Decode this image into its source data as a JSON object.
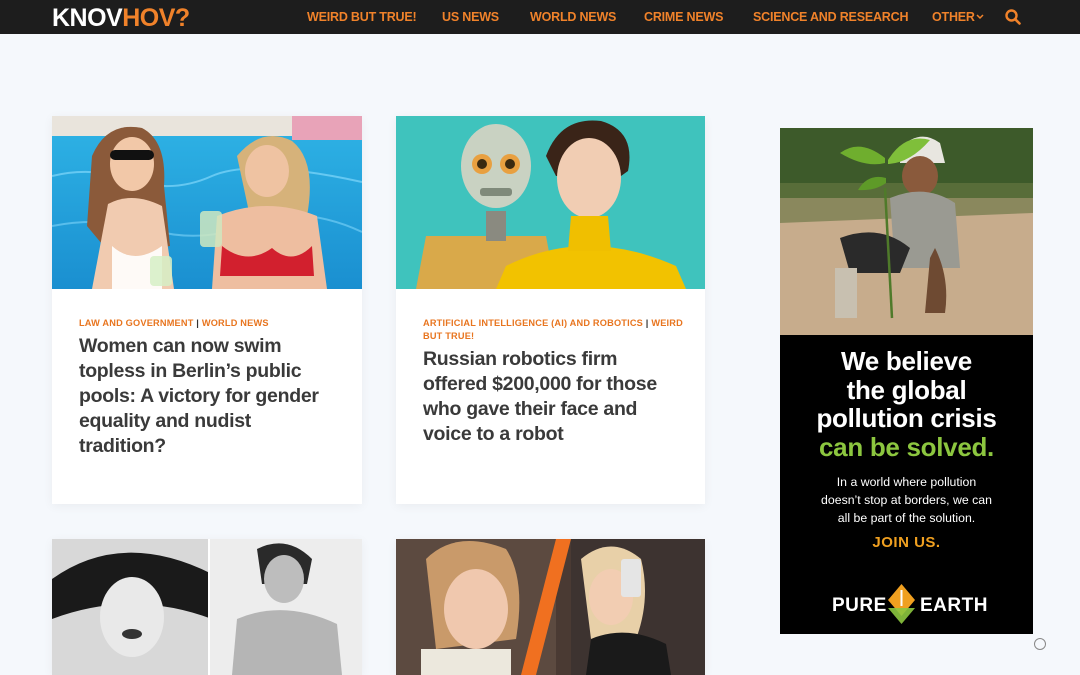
{
  "header": {
    "logo_part1": "KNOV",
    "logo_part2": "HOV?",
    "nav": [
      "WEIRD BUT TRUE!",
      "US NEWS",
      "WORLD NEWS",
      "CRIME NEWS",
      "SCIENCE AND RESEARCH",
      "OTHER"
    ],
    "search_icon": "search-icon",
    "dropdown_icon": "chevron-down-icon"
  },
  "articles": [
    {
      "cat1": "LAW AND GOVERNMENT",
      "sep": "|",
      "cat2": "WORLD NEWS",
      "title": "Women can now swim topless in Berlin’s public pools: A victory for gender equality and nudist tradition?"
    },
    {
      "cat1": "ARTIFICIAL INTELLIGENCE (AI) AND ROBOTICS",
      "sep": "|",
      "cat2": "WEIRD BUT TRUE!",
      "title": "Russian robotics firm offered $200,000 for those who gave their face and voice to a robot"
    }
  ],
  "ad": {
    "line1": "We believe",
    "line2": "the global",
    "line3": "pollution crisis",
    "line4": "can be solved.",
    "body1": "In a world where pollution",
    "body2": "doesn’t stop at borders, we can",
    "body3": "all be part of the solution.",
    "cta": "JOIN US.",
    "brand_left": "PURE",
    "brand_right": "EARTH",
    "adchoices_icon": "adchoices-icon"
  },
  "colors": {
    "accent": "#f0822a",
    "header_bg": "#1d1d1d",
    "page_bg": "#f5f8fc",
    "ad_green": "#8cc63f"
  }
}
